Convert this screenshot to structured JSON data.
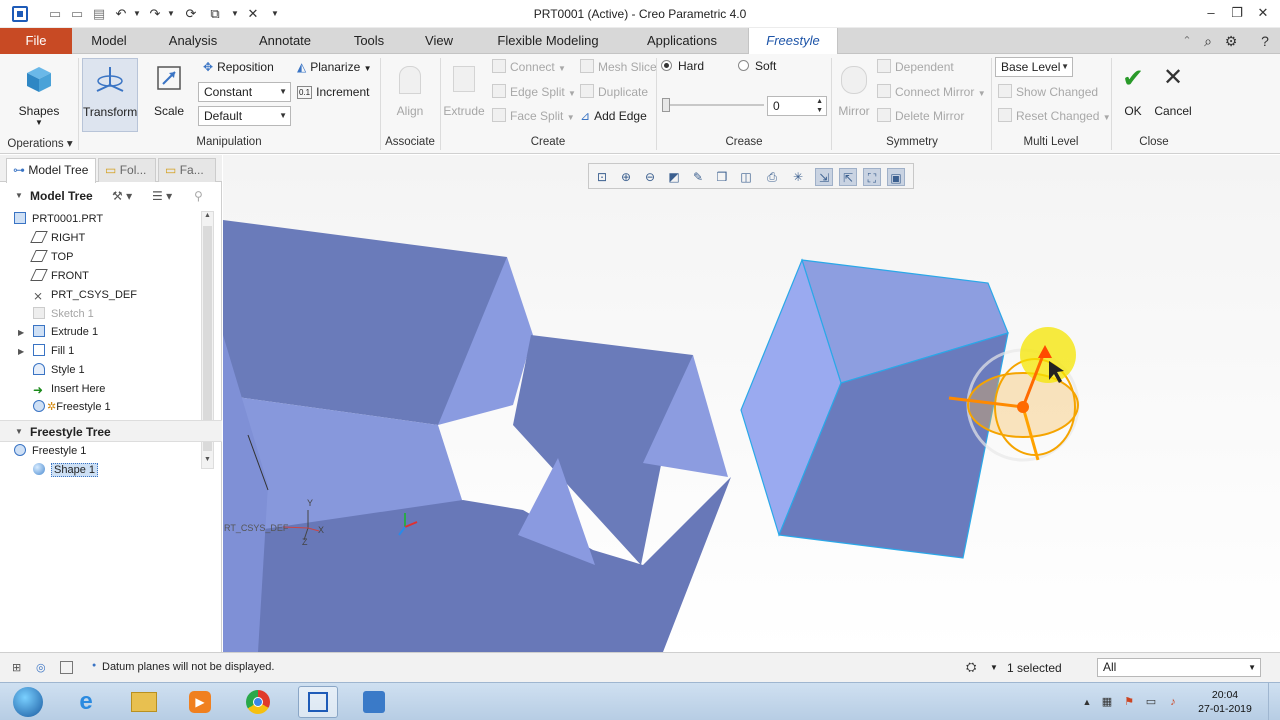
{
  "window": {
    "title": "PRT0001 (Active) - Creo Parametric 4.0"
  },
  "ribbon_tabs": [
    "File",
    "Model",
    "Analysis",
    "Annotate",
    "Tools",
    "View",
    "Flexible Modeling",
    "Applications",
    "Freestyle"
  ],
  "ribbon": {
    "operations": {
      "shapes": "Shapes",
      "group_label": "Operations"
    },
    "manipulation": {
      "transform": "Transform",
      "scale": "Scale",
      "reposition": "Reposition",
      "planarize": "Planarize",
      "constant": "Constant",
      "default": "Default",
      "increment": "Increment",
      "group_label": "Manipulation"
    },
    "associate": {
      "align": "Align",
      "group_label": "Associate"
    },
    "create": {
      "extrude": "Extrude",
      "connect": "Connect",
      "mesh_slice": "Mesh Slice",
      "edge_split": "Edge Split",
      "duplicate": "Duplicate",
      "face_split": "Face Split",
      "add_edge": "Add Edge",
      "group_label": "Create"
    },
    "crease": {
      "hard": "Hard",
      "soft": "Soft",
      "value": "0",
      "group_label": "Crease"
    },
    "symmetry": {
      "mirror": "Mirror",
      "dependent": "Dependent",
      "connect_mirror": "Connect Mirror",
      "delete_mirror": "Delete Mirror",
      "group_label": "Symmetry"
    },
    "multi_level": {
      "base_level": "Base Level",
      "show_changed": "Show Changed",
      "reset_changed": "Reset Changed",
      "group_label": "Multi Level"
    },
    "close": {
      "ok": "OK",
      "cancel": "Cancel",
      "group_label": "Close"
    }
  },
  "left_panel": {
    "tabs": [
      "Model Tree",
      "Fol...",
      "Fa..."
    ],
    "model_tree_header": "Model Tree",
    "model_tree": [
      {
        "label": "PRT0001.PRT",
        "icon": "part-icon"
      },
      {
        "label": "RIGHT",
        "icon": "datum-plane-icon"
      },
      {
        "label": "TOP",
        "icon": "datum-plane-icon"
      },
      {
        "label": "FRONT",
        "icon": "datum-plane-icon"
      },
      {
        "label": "PRT_CSYS_DEF",
        "icon": "csys-icon"
      },
      {
        "label": "Sketch 1",
        "icon": "sketch-icon"
      },
      {
        "label": "Extrude 1",
        "icon": "extrude-icon"
      },
      {
        "label": "Fill 1",
        "icon": "fill-icon"
      },
      {
        "label": "Style 1",
        "icon": "style-icon"
      },
      {
        "label": "Insert Here",
        "icon": "insert-arrow-icon"
      },
      {
        "label": "Freestyle 1",
        "icon": "freestyle-icon"
      }
    ],
    "freestyle_tree_header": "Freestyle Tree",
    "freestyle_tree": [
      {
        "label": "Freestyle 1",
        "icon": "freestyle-icon"
      },
      {
        "label": "Shape 1",
        "icon": "sphere-icon"
      }
    ]
  },
  "viewport": {
    "csys_label": "RT_CSYS_DEF",
    "axis_x": "X",
    "axis_y": "Y",
    "axis_z": "Z"
  },
  "status": {
    "message": "Datum planes will not be displayed.",
    "selected": "1 selected",
    "filter": "All"
  },
  "taskbar": {
    "time": "20:04",
    "date": "27-01-2019"
  },
  "colors": {
    "file_tab": "#c84a24",
    "freestyle_tab_text": "#1e55a8",
    "solid_dark": "#6a7cb8",
    "solid_light": "#8d9ee0",
    "dragger": "#f5a400"
  }
}
